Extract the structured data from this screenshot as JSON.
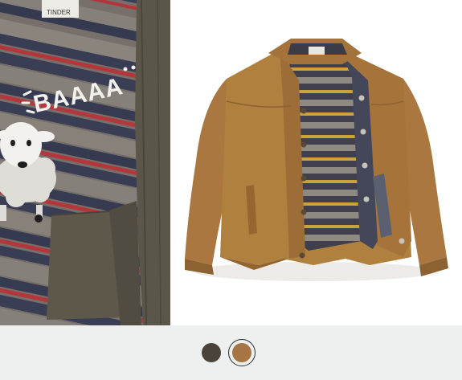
{
  "gallery": {
    "detail_photo": {
      "label_text": "TINDER",
      "graphic_text": "BAAAA"
    }
  },
  "swatches": {
    "colors": [
      "#4a433c",
      "#a77443"
    ],
    "selected_index": 1
  }
}
